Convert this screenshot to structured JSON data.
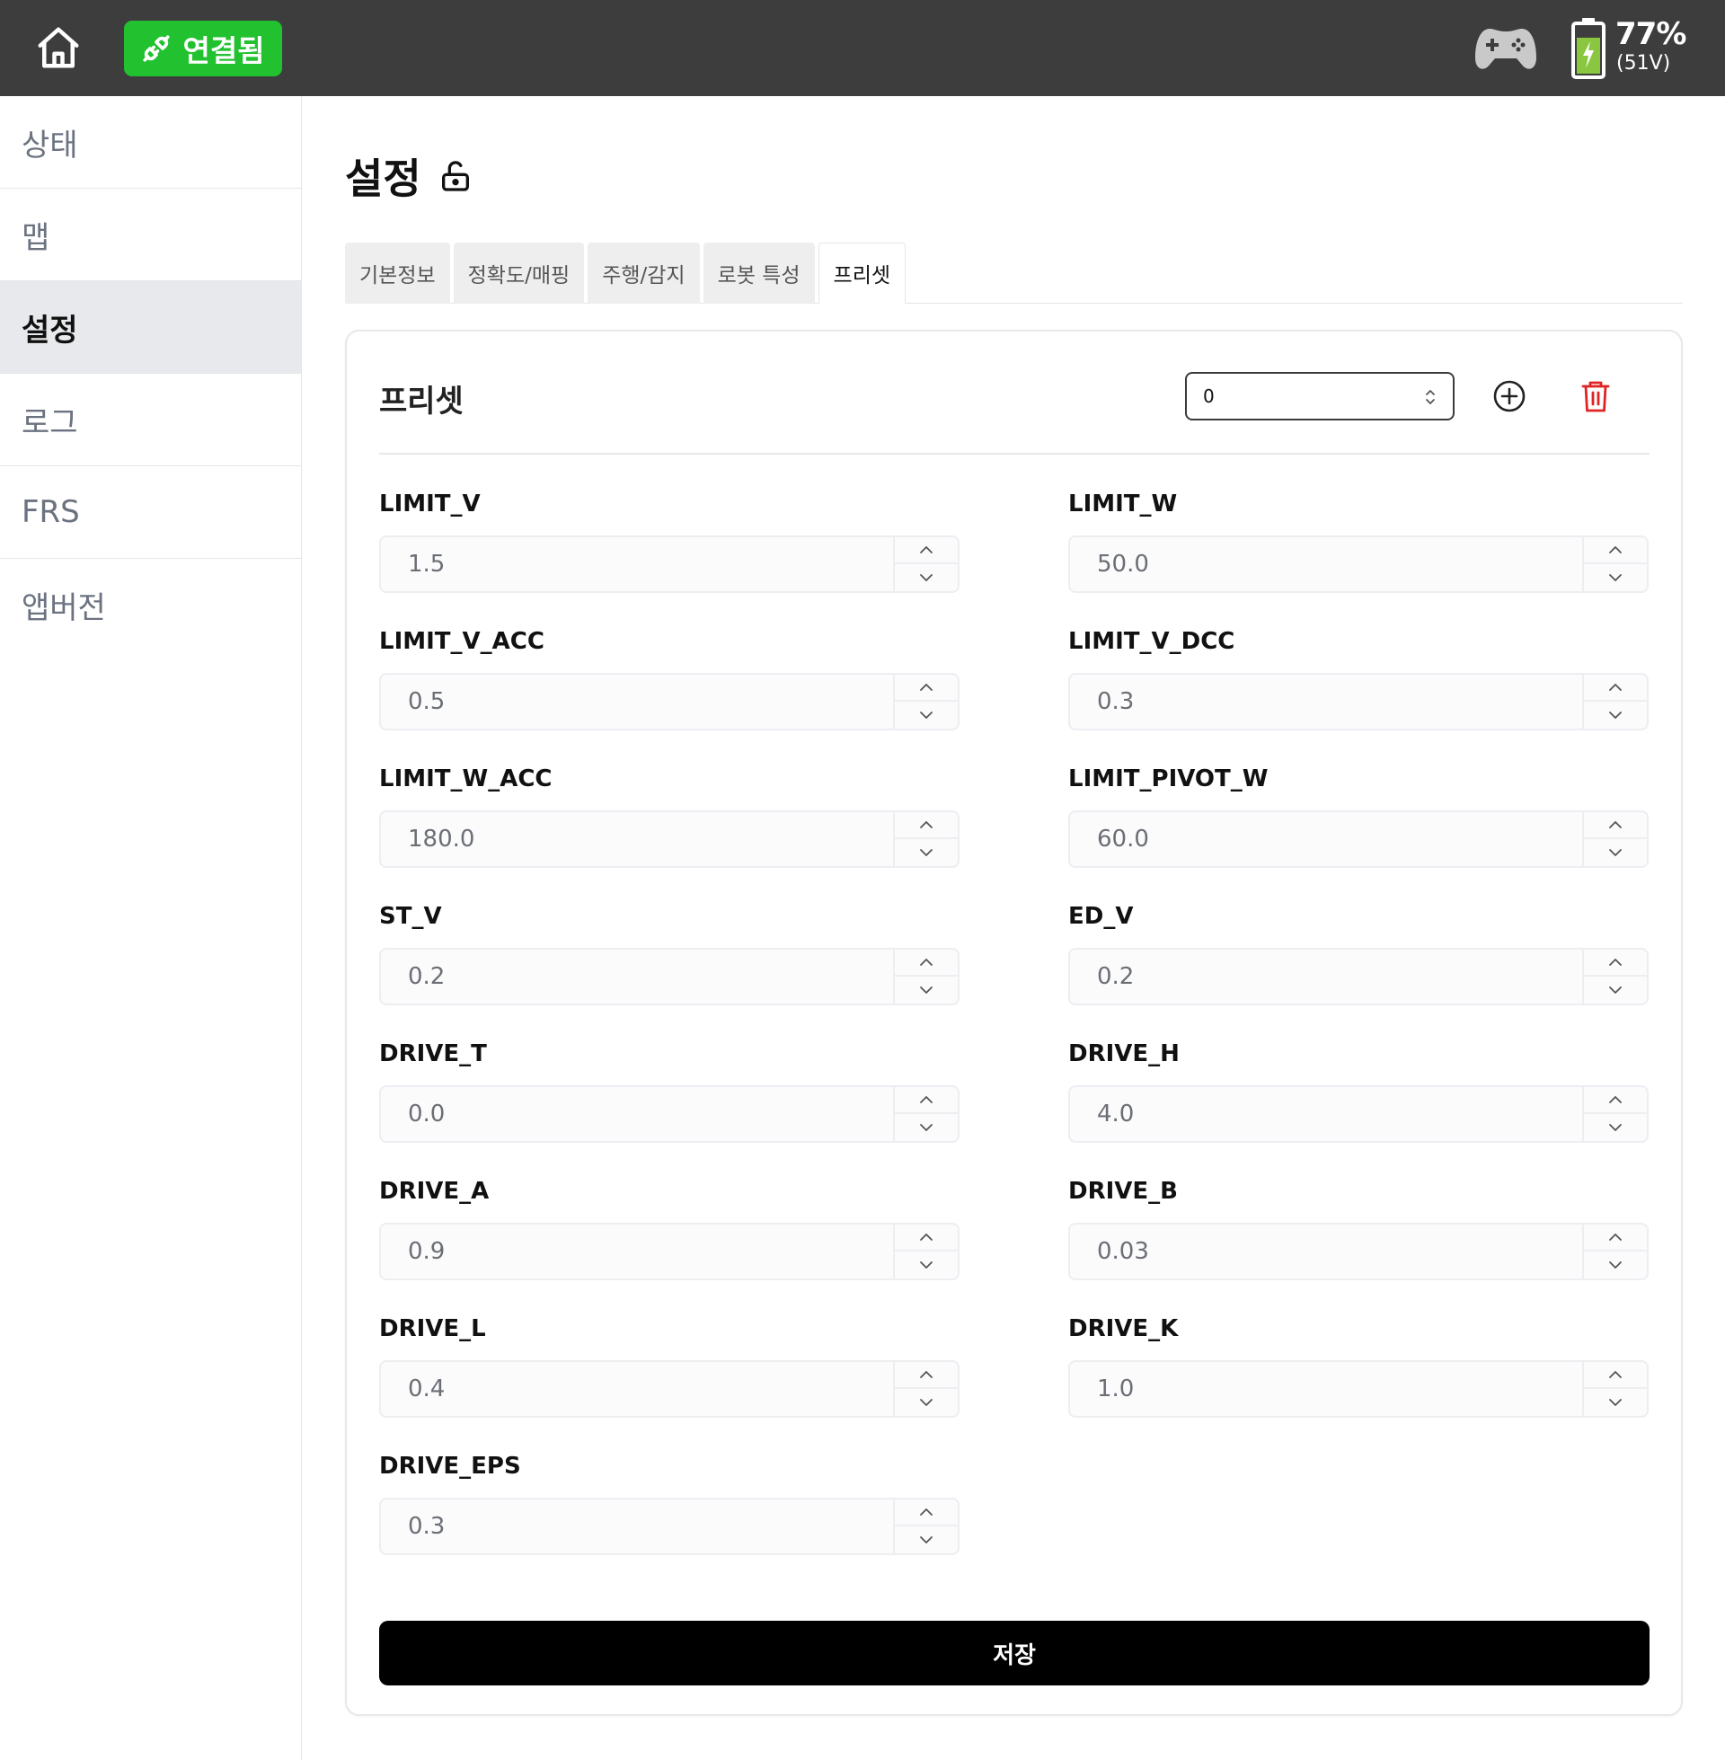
{
  "topbar": {
    "connection_label": "연결됨",
    "battery_percent": "77%",
    "battery_voltage": "(51V)",
    "battery_level": 0.77,
    "connection_color": "#22c12f"
  },
  "sidebar": {
    "items": [
      {
        "label": "상태",
        "active": false
      },
      {
        "label": "맵",
        "active": false
      },
      {
        "label": "설정",
        "active": true
      },
      {
        "label": "로그",
        "active": false
      },
      {
        "label": "FRS",
        "active": false
      },
      {
        "label": "앱버전",
        "active": false
      }
    ]
  },
  "page": {
    "title": "설정",
    "tabs": [
      {
        "label": "기본정보",
        "active": false
      },
      {
        "label": "정확도/매핑",
        "active": false
      },
      {
        "label": "주행/감지",
        "active": false
      },
      {
        "label": "로봇 특성",
        "active": false
      },
      {
        "label": "프리셋",
        "active": true
      }
    ]
  },
  "preset": {
    "title": "프리셋",
    "selected": "0",
    "save_label": "저장",
    "delete_color": "#e02424",
    "fields": [
      {
        "label": "LIMIT_V",
        "value": "1.5"
      },
      {
        "label": "LIMIT_W",
        "value": "50.0"
      },
      {
        "label": "LIMIT_V_ACC",
        "value": "0.5"
      },
      {
        "label": "LIMIT_V_DCC",
        "value": "0.3"
      },
      {
        "label": "LIMIT_W_ACC",
        "value": "180.0"
      },
      {
        "label": "LIMIT_PIVOT_W",
        "value": "60.0"
      },
      {
        "label": "ST_V",
        "value": "0.2"
      },
      {
        "label": "ED_V",
        "value": "0.2"
      },
      {
        "label": "DRIVE_T",
        "value": "0.0"
      },
      {
        "label": "DRIVE_H",
        "value": "4.0"
      },
      {
        "label": "DRIVE_A",
        "value": "0.9"
      },
      {
        "label": "DRIVE_B",
        "value": "0.03"
      },
      {
        "label": "DRIVE_L",
        "value": "0.4"
      },
      {
        "label": "DRIVE_K",
        "value": "1.0"
      },
      {
        "label": "DRIVE_EPS",
        "value": "0.3"
      }
    ]
  }
}
